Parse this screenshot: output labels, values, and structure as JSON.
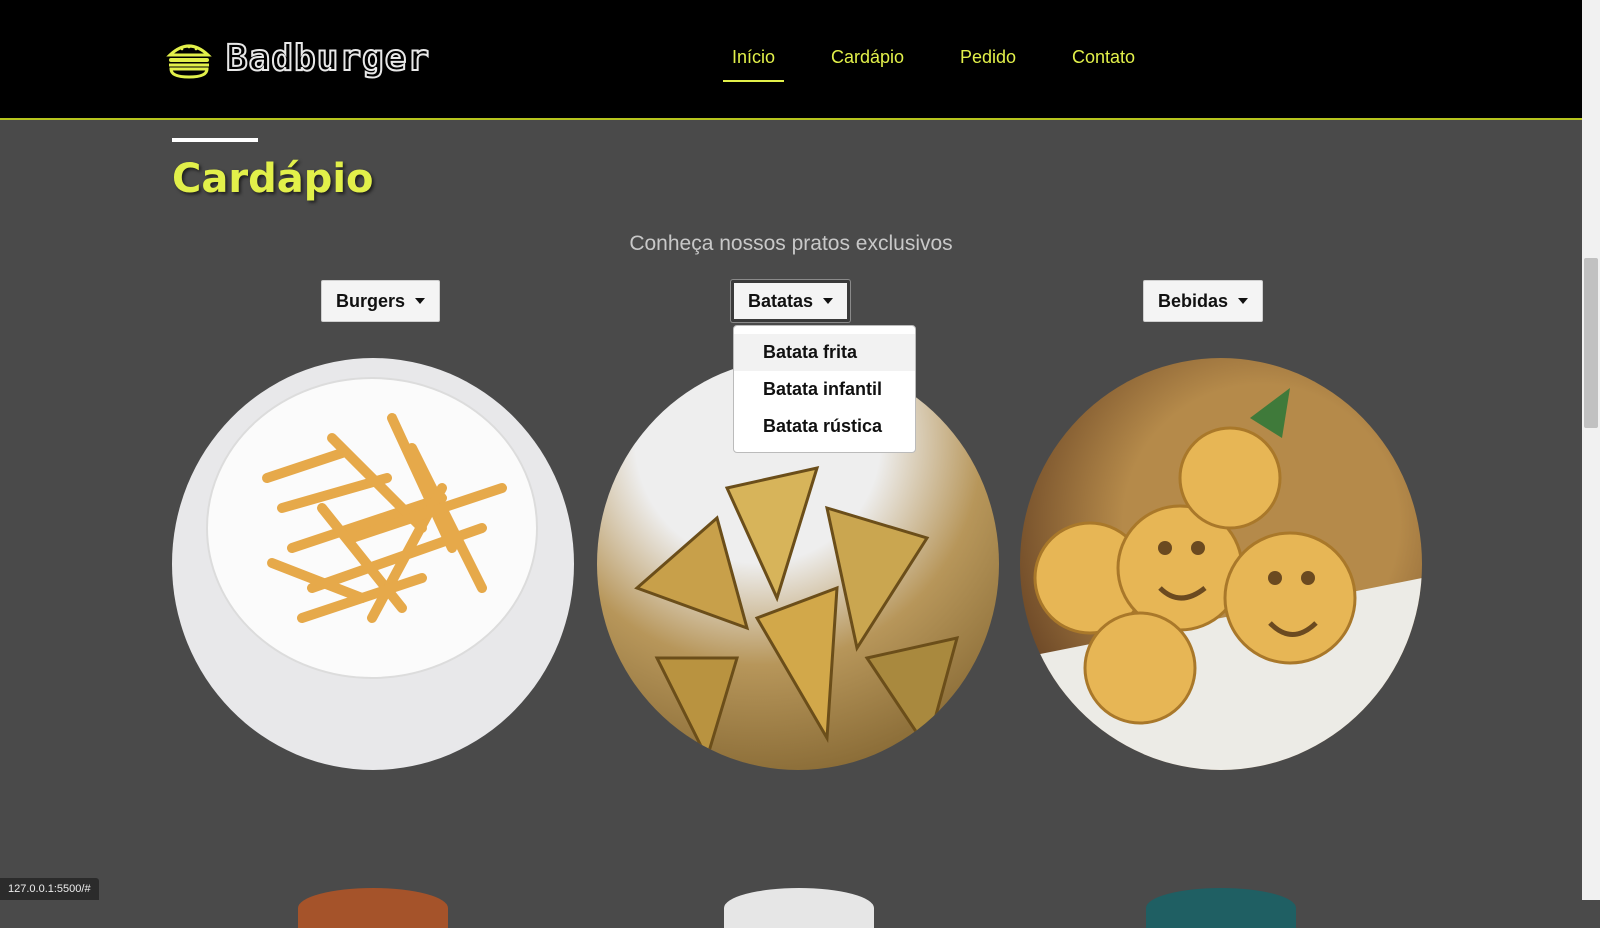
{
  "brand": {
    "name": "Badburger",
    "icon": "burger-icon"
  },
  "nav": [
    {
      "label": "Início",
      "active": true
    },
    {
      "label": "Cardápio"
    },
    {
      "label": "Pedido"
    },
    {
      "label": "Contato"
    }
  ],
  "section": {
    "title": "Cardápio",
    "subtitle": "Conheça nossos pratos exclusivos"
  },
  "dropdowns": {
    "burgers": {
      "label": "Burgers"
    },
    "batatas": {
      "label": "Batatas",
      "open": true,
      "items": [
        "Batata frita",
        "Batata infantil",
        "Batata rústica"
      ]
    },
    "bebidas": {
      "label": "Bebidas"
    }
  },
  "dishes": [
    {
      "name": "fries-plate-image"
    },
    {
      "name": "rustic-potatoes-image"
    },
    {
      "name": "smiley-potatoes-image"
    }
  ],
  "status_url": "127.0.0.1:5500/#",
  "colors": {
    "accent": "#e2f04a",
    "background": "#4a4a4a",
    "header": "#000000"
  }
}
